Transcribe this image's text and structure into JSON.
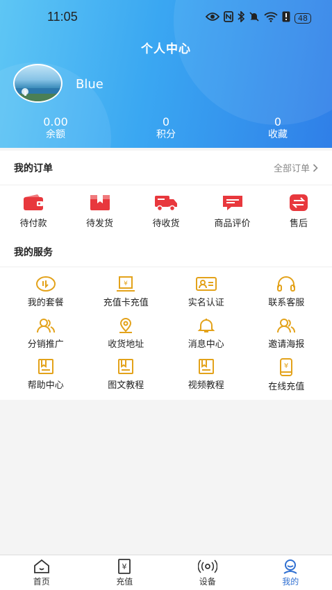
{
  "status_bar": {
    "time": "11:05",
    "battery": "48"
  },
  "header": {
    "title": "个人中心",
    "username": "Blue"
  },
  "stats": [
    {
      "value": "0.00",
      "label": "余额"
    },
    {
      "value": "0",
      "label": "积分"
    },
    {
      "value": "0",
      "label": "收藏"
    }
  ],
  "orders": {
    "heading": "我的订单",
    "more": "全部订单",
    "items": [
      {
        "label": "待付款",
        "icon": "wallet-icon"
      },
      {
        "label": "待发货",
        "icon": "package-icon"
      },
      {
        "label": "待收货",
        "icon": "truck-icon"
      },
      {
        "label": "商品评价",
        "icon": "comment-icon"
      },
      {
        "label": "售后",
        "icon": "exchange-icon"
      }
    ]
  },
  "services": {
    "heading": "我的服务",
    "items": [
      {
        "label": "我的套餐",
        "icon": "package-plan-icon"
      },
      {
        "label": "充值卡充值",
        "icon": "recharge-card-icon"
      },
      {
        "label": "实名认证",
        "icon": "id-card-icon"
      },
      {
        "label": "联系客服",
        "icon": "headset-icon"
      },
      {
        "label": "分销推广",
        "icon": "users-icon"
      },
      {
        "label": "收货地址",
        "icon": "location-icon"
      },
      {
        "label": "消息中心",
        "icon": "bell-icon"
      },
      {
        "label": "邀请海报",
        "icon": "invite-users-icon"
      },
      {
        "label": "帮助中心",
        "icon": "help-book-icon"
      },
      {
        "label": "图文教程",
        "icon": "image-tutorial-icon"
      },
      {
        "label": "视频教程",
        "icon": "video-tutorial-icon"
      },
      {
        "label": "在线充值",
        "icon": "phone-recharge-icon"
      }
    ]
  },
  "tabbar": {
    "items": [
      {
        "label": "首页",
        "icon": "home-icon"
      },
      {
        "label": "充值",
        "icon": "recharge-icon"
      },
      {
        "label": "设备",
        "icon": "device-icon"
      },
      {
        "label": "我的",
        "icon": "profile-icon"
      }
    ],
    "active_index": 3
  },
  "colors": {
    "accent": "#2f6fd1",
    "order_icon": "#e8383d",
    "service_icon": "#e3a21a"
  }
}
